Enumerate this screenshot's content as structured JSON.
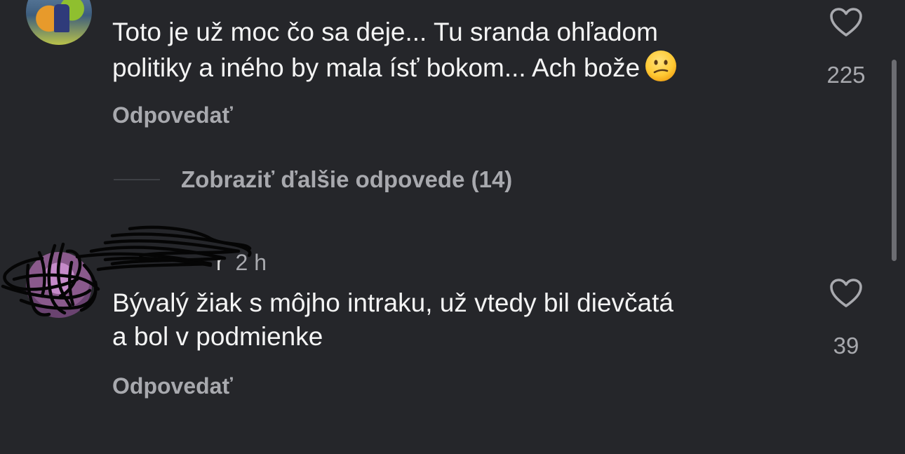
{
  "comments": [
    {
      "text_line1": "Toto je už moc čo sa deje... Tu sranda ohľadom",
      "text_line2": "politiky a iného by mala ísť bokom... Ach bože",
      "emoji": "confused-face-emoji",
      "likes": "225",
      "reply_label": "Odpovedať"
    },
    {
      "username": "r",
      "time": "2 h",
      "text_line1": "Bývalý žiak s môjho intraku, už vtedy bil dievčatá",
      "text_line2": "a bol v podmienke",
      "likes": "39",
      "reply_label": "Odpovedať"
    }
  ],
  "more_replies": {
    "label": "Zobraziť ďalšie odpovede (14)"
  },
  "colors": {
    "background": "#25262a",
    "text": "#f4f4f4",
    "muted": "#a8a9ae",
    "scrollbar": "#6c6d72"
  },
  "icons": {
    "like": "heart-icon",
    "redaction": "scribble-redaction"
  }
}
